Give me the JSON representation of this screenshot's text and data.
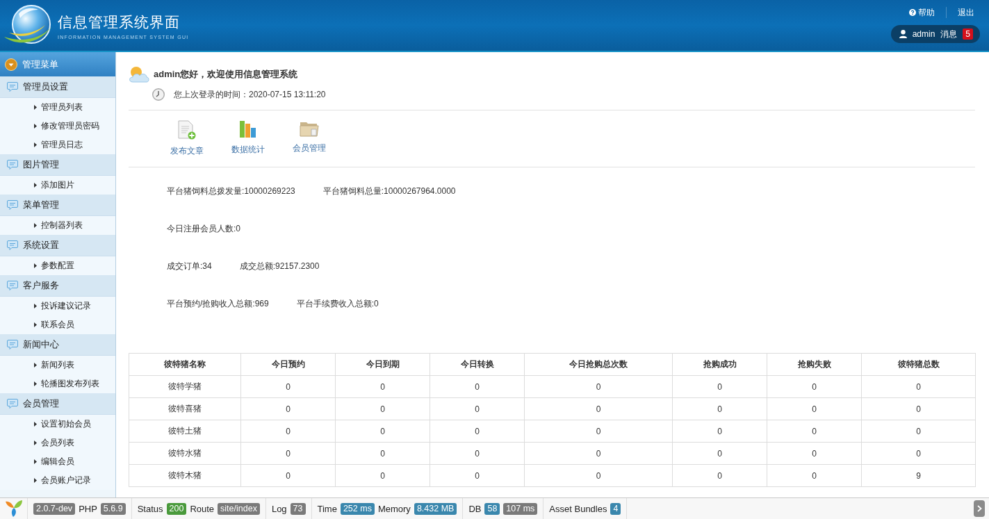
{
  "header": {
    "title": "信息管理系统界面",
    "subtitle": "INFORMATION MANAGEMENT SYSTEM GUI",
    "links": [
      {
        "label": "帮助",
        "kind": "help"
      },
      {
        "label": "退出",
        "kind": "logout"
      }
    ],
    "user": {
      "name": "admin",
      "messages": "消息",
      "count": "5"
    }
  },
  "sidebar": {
    "title": "管理菜单",
    "sections": [
      {
        "label": "管理员设置",
        "children": [
          {
            "label": "管理员列表"
          },
          {
            "label": "修改管理员密码"
          },
          {
            "label": "管理员日志"
          }
        ]
      },
      {
        "label": "图片管理",
        "children": [
          {
            "label": "添加图片"
          }
        ]
      },
      {
        "label": "菜单管理",
        "children": [
          {
            "label": "控制器列表"
          }
        ]
      },
      {
        "label": "系统设置",
        "children": [
          {
            "label": "参数配置"
          }
        ]
      },
      {
        "label": "客户服务",
        "children": [
          {
            "label": "投诉建议记录"
          },
          {
            "label": "联系会员"
          }
        ]
      },
      {
        "label": "新闻中心",
        "children": [
          {
            "label": "新闻列表"
          },
          {
            "label": "轮播图发布列表"
          }
        ]
      },
      {
        "label": "会员管理",
        "children": [
          {
            "label": "设置初始会员"
          },
          {
            "label": "会员列表"
          },
          {
            "label": "编辑会员"
          },
          {
            "label": "会员账户记录"
          }
        ]
      }
    ]
  },
  "welcome": {
    "greeting": "admin您好，欢迎使用信息管理系统",
    "last_login": "您上次登录的时间：2020-07-15 13:11:20"
  },
  "shortcuts": [
    {
      "label": "发布文章",
      "kind": "document"
    },
    {
      "label": "数据统计",
      "kind": "chart"
    },
    {
      "label": "会员管理",
      "kind": "folder"
    }
  ],
  "stats": [
    {
      "items": [
        "平台猪饲料总拨发量:10000269223",
        "平台猪饲料总量:10000267964.0000"
      ]
    },
    {
      "items": [
        "今日注册会员人数:0"
      ]
    },
    {
      "items": [
        "成交订单:34",
        "成交总额:92157.2300"
      ]
    },
    {
      "items": [
        "平台预约/抢购收入总额:969",
        "平台手续费收入总额:0"
      ]
    }
  ],
  "table": {
    "columns": [
      "彼特猪名称",
      "今日预约",
      "今日到期",
      "今日转换",
      "今日抢购总次数",
      "抢购成功",
      "抢购失败",
      "彼特猪总数"
    ],
    "rows": [
      [
        "彼特学猪",
        "0",
        "0",
        "0",
        "0",
        "0",
        "0",
        "0"
      ],
      [
        "彼特喜猪",
        "0",
        "0",
        "0",
        "0",
        "0",
        "0",
        "0"
      ],
      [
        "彼特土猪",
        "0",
        "0",
        "0",
        "0",
        "0",
        "0",
        "0"
      ],
      [
        "彼特水猪",
        "0",
        "0",
        "0",
        "0",
        "0",
        "0",
        "0"
      ],
      [
        "彼特木猪",
        "0",
        "0",
        "0",
        "0",
        "0",
        "0",
        "9"
      ]
    ]
  },
  "debug_bar": {
    "blocks": [
      {
        "parts": [
          {
            "badge": "2.0.7-dev",
            "color": "#7a7a7a"
          },
          {
            "label": "PHP",
            "badge": "5.6.9",
            "color": "#7a7a7a"
          }
        ]
      },
      {
        "parts": [
          {
            "label": "Status",
            "badge": "200",
            "color": "#4a9a3c"
          },
          {
            "label": "Route",
            "badge": "site/index",
            "color": "#7a7a7a"
          }
        ]
      },
      {
        "parts": [
          {
            "label": "Log",
            "badge": "73",
            "color": "#7a7a7a"
          }
        ]
      },
      {
        "parts": [
          {
            "label": "Time",
            "badge": "252 ms",
            "color": "#3a87ad"
          },
          {
            "label": "Memory",
            "badge": "8.432 MB",
            "color": "#3a87ad"
          }
        ]
      },
      {
        "parts": [
          {
            "label": "DB",
            "badge": "58",
            "color": "#3a87ad"
          },
          {
            "badge": "107 ms",
            "color": "#7a7a7a"
          }
        ]
      },
      {
        "parts": [
          {
            "label": "Asset Bundles",
            "badge": "4",
            "color": "#3a87ad"
          }
        ]
      }
    ]
  }
}
